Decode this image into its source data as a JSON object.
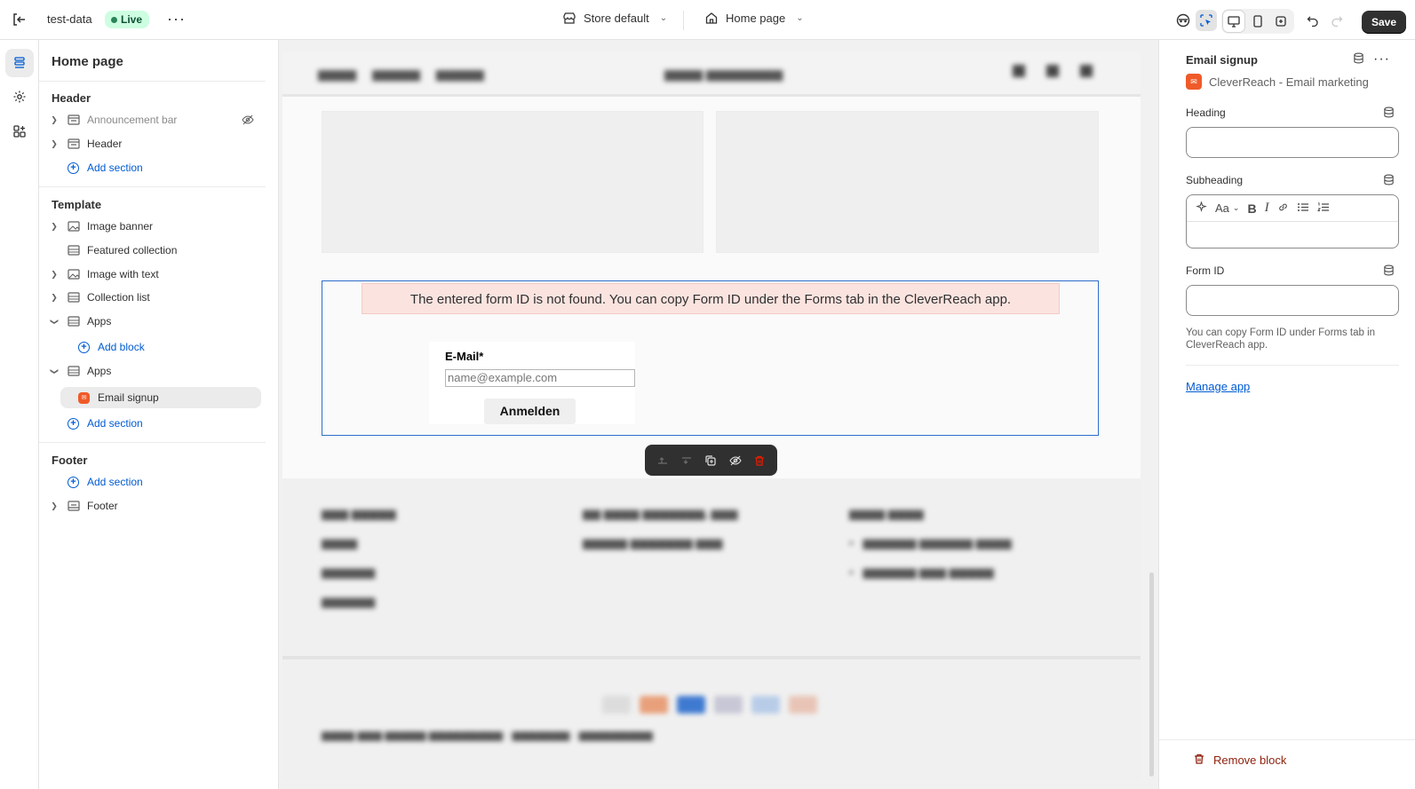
{
  "topbar": {
    "store_name": "test-data",
    "status": "Live",
    "theme_selector": "Store default",
    "page_selector": "Home page",
    "save_label": "Save"
  },
  "sidebar": {
    "title": "Home page",
    "header_group": {
      "title": "Header",
      "items": [
        {
          "label": "Announcement bar",
          "hidden": true
        },
        {
          "label": "Header"
        }
      ],
      "add_section": "Add section"
    },
    "template_group": {
      "title": "Template",
      "items": [
        {
          "label": "Image banner"
        },
        {
          "label": "Featured collection"
        },
        {
          "label": "Image with text"
        },
        {
          "label": "Collection list"
        },
        {
          "label": "Apps"
        },
        {
          "label": "Apps"
        }
      ],
      "add_block": "Add block",
      "selected_block": "Email signup",
      "add_section": "Add section"
    },
    "footer_group": {
      "title": "Footer",
      "add_section": "Add section",
      "items": [
        {
          "label": "Footer"
        }
      ]
    }
  },
  "preview": {
    "error_message": "The entered form ID is not found. You can copy Form ID under the Forms tab in the CleverReach app.",
    "form": {
      "email_label": "E-Mail*",
      "email_placeholder": "name@example.com",
      "submit_label": "Anmelden"
    }
  },
  "settings": {
    "title": "Email signup",
    "app_name": "CleverReach - Email marketing",
    "fields": {
      "heading_label": "Heading",
      "subheading_label": "Subheading",
      "rte_font_label": "Aa",
      "form_id_label": "Form ID",
      "form_id_help": "You can copy Form ID under Forms tab in CleverReach app."
    },
    "manage_app": "Manage app",
    "remove_block": "Remove block"
  },
  "colors": {
    "accent": "#005bd3",
    "selection_outline": "#2c6ecb",
    "error_bg": "#fbe4e0",
    "live_badge_bg": "#cdfee1",
    "danger": "#8e1f0b",
    "app_logo": "#f05a28"
  }
}
